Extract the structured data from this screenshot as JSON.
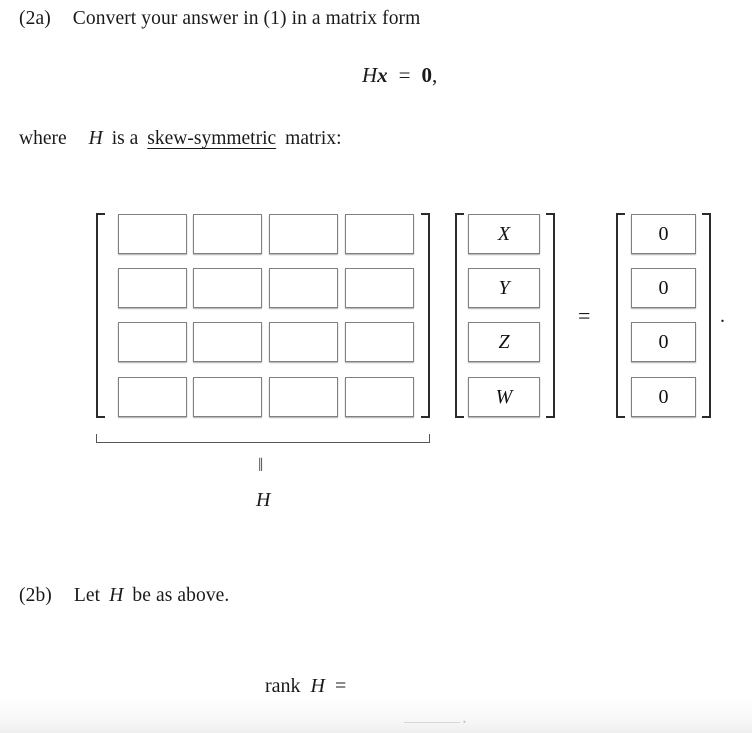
{
  "document": {
    "problem_a": {
      "tag": "(2a)",
      "statement": "Convert your answer in (1) in a matrix form",
      "equation": {
        "matrix_symbol": "H",
        "vector_symbol": "x",
        "relation": "=",
        "rhs": "0",
        "trailing": ","
      },
      "where_line": {
        "where": "where",
        "symbol": "H",
        "is_a": "is a",
        "blank_answer": "skew-symmetric",
        "matrix_word": "matrix:"
      }
    },
    "problem_b": {
      "tag": "(2b)",
      "statement": "Let",
      "symbol": "H",
      "statement_tail": "be as above.",
      "rank_prompt": {
        "rank_word": "rank",
        "symbol": "H",
        "equals": "=",
        "answer_value": "",
        "trailing_period": "."
      }
    }
  },
  "matrix_equation": {
    "coefficient_matrix": {
      "label_under_brace": "H",
      "brace_connector": "‖",
      "rows": 4,
      "cols": 4,
      "cells": [
        [
          "",
          "",
          "",
          ""
        ],
        [
          "",
          "",
          "",
          ""
        ],
        [
          "",
          "",
          "",
          ""
        ],
        [
          "",
          "",
          "",
          ""
        ]
      ]
    },
    "unknown_vector": {
      "cells": [
        "X",
        "Y",
        "Z",
        "W"
      ]
    },
    "equals_sign": "=",
    "zero_vector": {
      "cells": [
        "0",
        "0",
        "0",
        "0"
      ]
    },
    "trailing_period": "."
  },
  "style": {
    "box_border_color": "#808080",
    "bracket_color": "#2b2b2b",
    "text_color": "#1a1a1a",
    "page_background": "#ffffff"
  }
}
